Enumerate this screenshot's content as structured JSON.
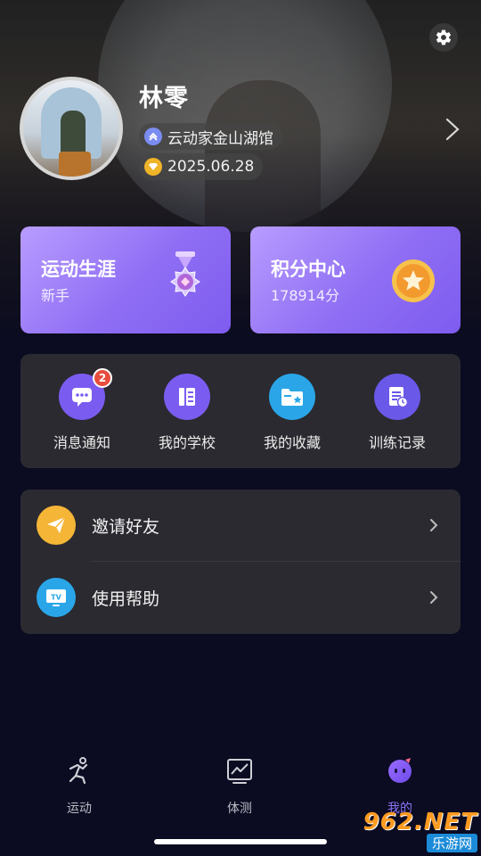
{
  "profile": {
    "name": "林零",
    "school": "云动家金山湖馆",
    "date": "2025.06.28"
  },
  "cards": {
    "career": {
      "title": "运动生涯",
      "subtitle": "新手"
    },
    "points": {
      "title": "积分中心",
      "subtitle": "178914分"
    }
  },
  "quick_actions": [
    {
      "label": "消息通知",
      "icon": "chat-bubble-icon",
      "color": "#7b5cf0",
      "badge": "2"
    },
    {
      "label": "我的学校",
      "icon": "school-book-icon",
      "color": "#7b5cf0"
    },
    {
      "label": "我的收藏",
      "icon": "folder-star-icon",
      "color": "#2aa6e8"
    },
    {
      "label": "训练记录",
      "icon": "record-clock-icon",
      "color": "#6a58e8"
    }
  ],
  "list": [
    {
      "label": "邀请好友",
      "icon": "paper-plane-icon",
      "color": "#f5b536"
    },
    {
      "label": "使用帮助",
      "icon": "tv-icon",
      "color": "#2aa6e8"
    }
  ],
  "tabs": [
    {
      "label": "运动",
      "icon": "running-icon",
      "active": false
    },
    {
      "label": "体测",
      "icon": "chart-icon",
      "active": false
    },
    {
      "label": "我的",
      "icon": "mascot-icon",
      "active": true
    }
  ],
  "watermark": {
    "line1": "962.NET",
    "line2": "乐游网"
  },
  "colors": {
    "accent": "#8b74f5",
    "card_gradient_start": "#b89cff",
    "card_gradient_end": "#7e5cef",
    "panel": "#2a2a30",
    "background": "#0b0b22"
  }
}
